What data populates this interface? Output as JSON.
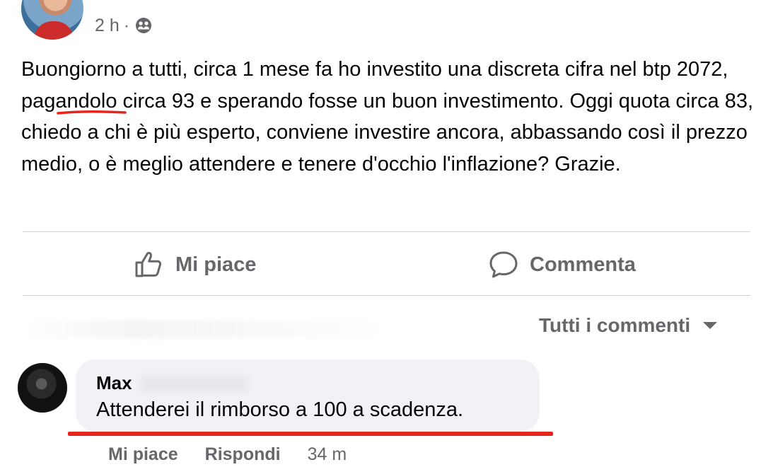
{
  "post": {
    "time": "2 h",
    "separator": "·",
    "audience_icon": "friends-icon",
    "text": "Buongiorno a tutti, circa 1 mese fa ho investito una discreta cifra nel btp 2072, pagandolo circa 93 e sperando fosse un buon investimento. Oggi quota circa 83, chiedo a chi è più esperto, conviene investire ancora, abbassando così il prezzo medio, o è meglio attendere e tenere d'occhio l'inflazione? Grazie."
  },
  "actions": {
    "like_label": "Mi piace",
    "like_icon": "thumbs-up-icon",
    "comment_label": "Commenta",
    "comment_icon": "speech-bubble-icon"
  },
  "comments_filter": {
    "label": "Tutti i commenti",
    "icon": "caret-down-icon"
  },
  "comment": {
    "author": "Max",
    "text": "Attenderei il rimborso a 100 a scadenza.",
    "like_label": "Mi piace",
    "reply_label": "Rispondi",
    "time": "34 m"
  },
  "colors": {
    "secondary_text": "#65676b",
    "bubble_bg": "#f0f2f5",
    "annotation_red": "#e8251c",
    "divider": "#ced0d4"
  }
}
